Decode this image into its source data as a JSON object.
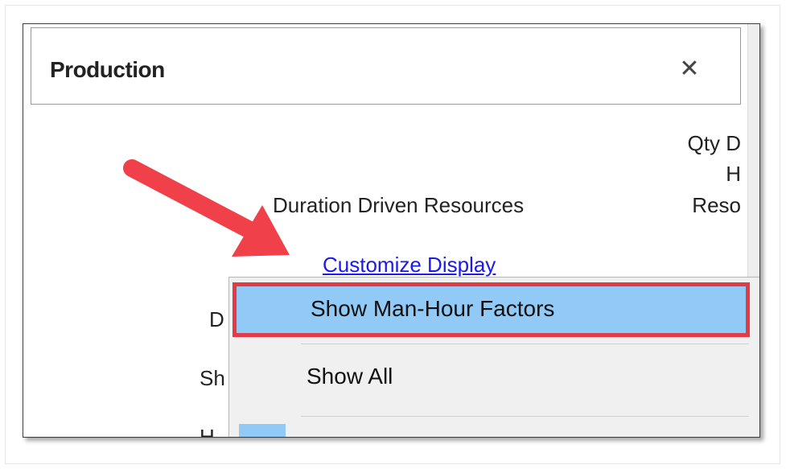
{
  "window": {
    "title": "Production",
    "close_glyph": "✕"
  },
  "columns": {
    "duration_driven_label": "Duration Driven Resources",
    "qty_col_line1": "Qty D",
    "qty_col_line2": "H",
    "qty_col_line3": "Reso"
  },
  "customize_link": "Customize Display",
  "left_fragments": {
    "frag1": "D",
    "frag2": "Sh",
    "frag3": "H"
  },
  "context_menu": {
    "items": [
      {
        "label": "Show Man-Hour Factors",
        "selected": true
      },
      {
        "label": "Show All",
        "selected": false
      }
    ]
  },
  "colors": {
    "highlight": "#91c9f7",
    "callout_red": "#e33a45",
    "link_blue": "#1a1aee"
  },
  "annotation": {
    "icon": "red-arrow-icon"
  }
}
